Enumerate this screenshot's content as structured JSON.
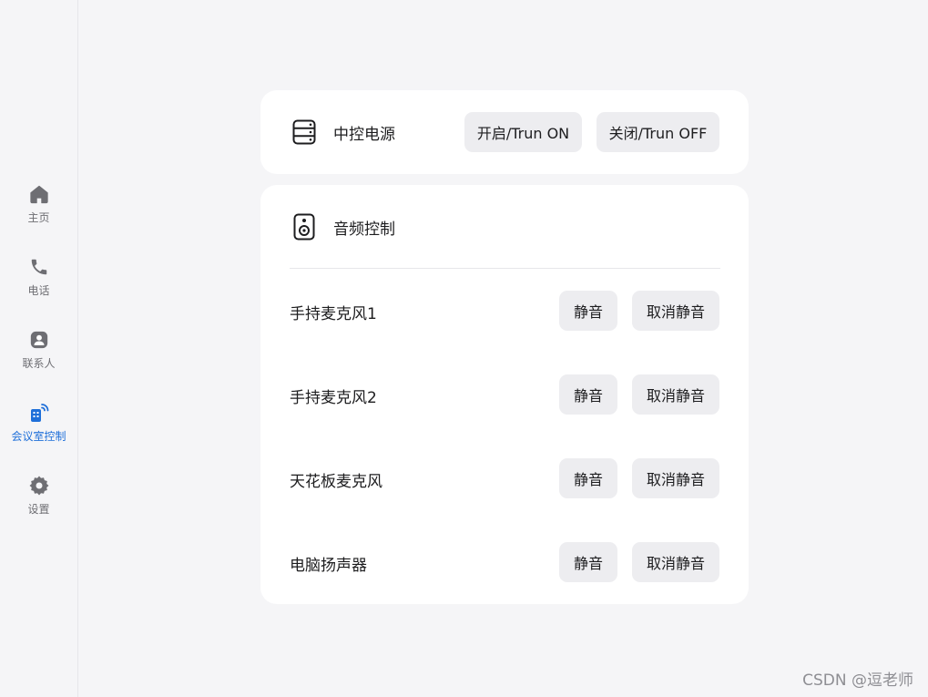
{
  "sidebar": {
    "items": [
      {
        "label": "主页",
        "icon": "home-icon",
        "active": false
      },
      {
        "label": "电话",
        "icon": "phone-icon",
        "active": false
      },
      {
        "label": "联系人",
        "icon": "contact-icon",
        "active": false
      },
      {
        "label": "会议室控制",
        "icon": "room-control-icon",
        "active": true
      },
      {
        "label": "设置",
        "icon": "gear-icon",
        "active": false
      }
    ]
  },
  "power": {
    "title": "中控电源",
    "icon": "server-icon",
    "on_label": "开启/Trun ON",
    "off_label": "关闭/Trun OFF"
  },
  "audio": {
    "title": "音频控制",
    "icon": "speaker-icon",
    "mute_label": "静音",
    "unmute_label": "取消静音",
    "devices": [
      {
        "name": "手持麦克风1"
      },
      {
        "name": "手持麦克风2"
      },
      {
        "name": "天花板麦克风"
      },
      {
        "name": "电脑扬声器"
      }
    ]
  },
  "watermark": "CSDN @逗老师",
  "colors": {
    "accent": "#1e6fd9",
    "icon_gray": "#6e6e73",
    "button_bg": "#ededf0",
    "card_bg": "#ffffff",
    "page_bg": "#f5f5f7"
  }
}
